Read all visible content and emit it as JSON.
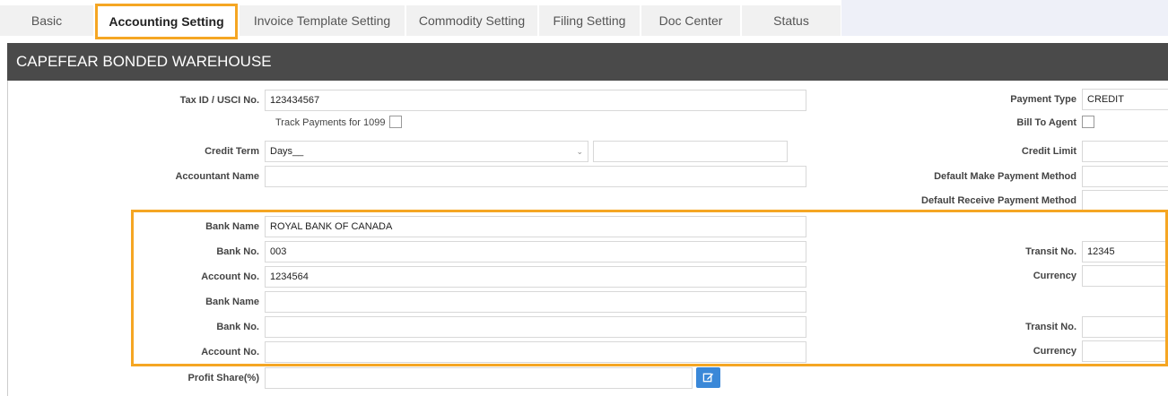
{
  "tabs": [
    {
      "label": "Basic"
    },
    {
      "label": "Accounting Setting"
    },
    {
      "label": "Invoice Template Setting"
    },
    {
      "label": "Commodity Setting"
    },
    {
      "label": "Filing Setting"
    },
    {
      "label": "Doc Center"
    },
    {
      "label": "Status"
    }
  ],
  "panel": {
    "title": "CAPEFEAR BONDED WAREHOUSE"
  },
  "form": {
    "tax_id_label": "Tax ID / USCI No.",
    "tax_id_value": "123434567",
    "track_payments_label": "Track Payments for 1099",
    "credit_term_label": "Credit Term",
    "credit_term_value": "Days__",
    "credit_term_extra": "",
    "accountant_name_label": "Accountant Name",
    "accountant_name_value": "",
    "payment_type_label": "Payment Type",
    "payment_type_value": "CREDIT",
    "bill_to_agent_label": "Bill To Agent",
    "credit_limit_label": "Credit Limit",
    "credit_limit_value": "",
    "default_make_payment_label": "Default Make Payment Method",
    "default_make_payment_value": "",
    "default_receive_payment_label": "Default Receive Payment Method",
    "default_receive_payment_value": "",
    "profit_share_label": "Profit Share(%)",
    "profit_share_value": ""
  },
  "bank1": {
    "bank_name_label": "Bank Name",
    "bank_name_value": "ROYAL BANK OF CANADA",
    "bank_no_label": "Bank No.",
    "bank_no_value": "003",
    "account_no_label": "Account No.",
    "account_no_value": "1234564",
    "transit_no_label": "Transit No.",
    "transit_no_value": "12345",
    "currency_label": "Currency",
    "currency_value": ""
  },
  "bank2": {
    "bank_name_label": "Bank Name",
    "bank_name_value": "",
    "bank_no_label": "Bank No.",
    "bank_no_value": "",
    "account_no_label": "Account No.",
    "account_no_value": "",
    "transit_no_label": "Transit No.",
    "transit_no_value": "",
    "currency_label": "Currency",
    "currency_value": ""
  },
  "colors": {
    "highlight": "#f5a623",
    "header_bg": "#4a4a4a",
    "button_blue": "#3a88d8"
  },
  "icons": {
    "edit": "edit-icon",
    "dropdown": "chevron-down-icon"
  }
}
